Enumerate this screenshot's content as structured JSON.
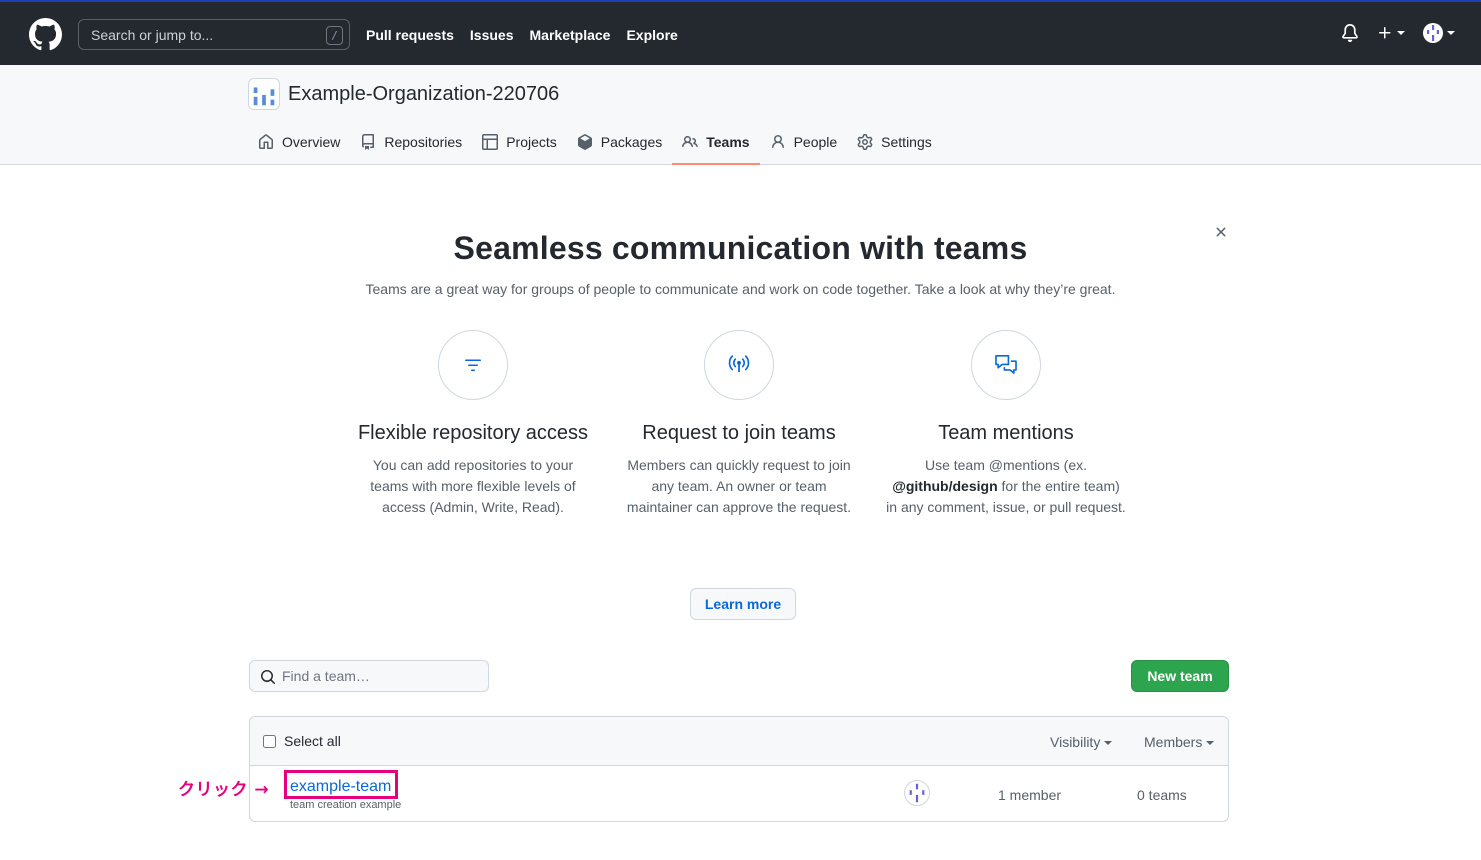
{
  "header": {
    "search_placeholder": "Search or jump to...",
    "slash_hint": "/",
    "nav": [
      "Pull requests",
      "Issues",
      "Marketplace",
      "Explore"
    ]
  },
  "org": {
    "name": "Example-Organization-220706",
    "tabs": [
      {
        "label": "Overview",
        "icon": "home-icon"
      },
      {
        "label": "Repositories",
        "icon": "repo-icon"
      },
      {
        "label": "Projects",
        "icon": "project-icon"
      },
      {
        "label": "Packages",
        "icon": "package-icon"
      },
      {
        "label": "Teams",
        "icon": "people-icon",
        "active": true
      },
      {
        "label": "People",
        "icon": "person-icon"
      },
      {
        "label": "Settings",
        "icon": "gear-icon"
      }
    ]
  },
  "onboarding": {
    "title": "Seamless communication with teams",
    "subtitle": "Teams are a great way for groups of people to communicate and work on code together. Take a look at why they’re great.",
    "features": [
      {
        "icon": "filter-icon",
        "title": "Flexible repository access",
        "desc": "You can add repositories to your teams with more flexible levels of access (Admin, Write, Read)."
      },
      {
        "icon": "broadcast-icon",
        "title": "Request to join teams",
        "desc": "Members can quickly request to join any team. An owner or team maintainer can approve the request."
      },
      {
        "icon": "comment-discussion-icon",
        "title": "Team mentions",
        "desc_pre": "Use team @mentions (ex. ",
        "desc_bold": "@github/design",
        "desc_post": " for the entire team) in any comment, issue, or pull request."
      }
    ],
    "learn_more": "Learn more"
  },
  "teams": {
    "search_placeholder": "Find a team…",
    "new_team": "New team",
    "select_all": "Select all",
    "visibility_filter": "Visibility",
    "members_filter": "Members",
    "rows": [
      {
        "name": "example-team",
        "description": "team creation example",
        "members": "1 member",
        "child_teams": "0 teams"
      }
    ]
  },
  "annotation": {
    "text": "クリック →",
    "color": "#e6007e"
  },
  "colors": {
    "header_bg": "#24292f",
    "link": "#0969da",
    "primary_button": "#2da44e",
    "active_tab_underline": "#fd8c73"
  }
}
